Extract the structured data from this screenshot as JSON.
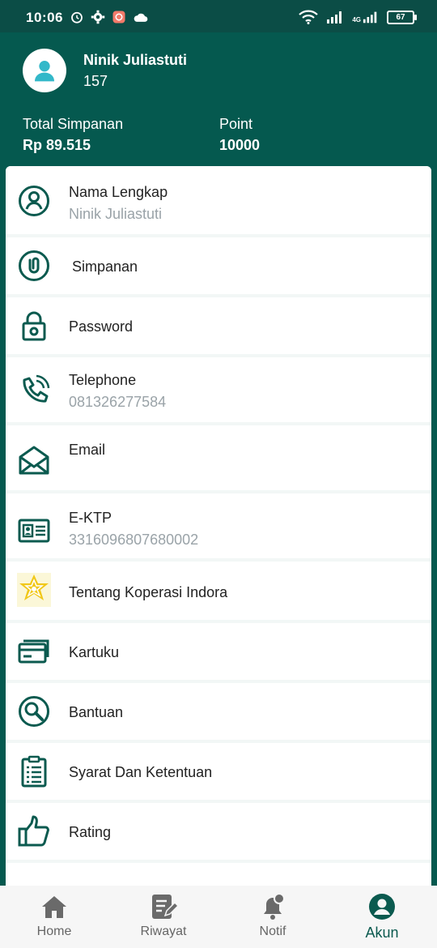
{
  "status_bar": {
    "time": "10:06",
    "battery": "67",
    "network": "4G"
  },
  "profile": {
    "name": "Ninik Juliastuti",
    "id": "157",
    "total_simpanan_label": "Total Simpanan",
    "total_simpanan_value": "Rp 89.515",
    "point_label": "Point",
    "point_value": "10000"
  },
  "menu": [
    {
      "title": "Nama Lengkap",
      "subtitle": "Ninik Juliastuti",
      "icon": "user-circle-icon"
    },
    {
      "title": "Simpanan",
      "subtitle": "",
      "icon": "savings-icon"
    },
    {
      "title": "Password",
      "subtitle": "",
      "icon": "lock-icon"
    },
    {
      "title": "Telephone",
      "subtitle": "081326277584",
      "icon": "phone-icon"
    },
    {
      "title": "Email",
      "subtitle": "",
      "icon": "envelope-icon"
    },
    {
      "title": "E-KTP",
      "subtitle": "3316096807680002",
      "icon": "id-card-icon"
    },
    {
      "title": "Tentang Koperasi Indora",
      "subtitle": "",
      "icon": "koperasi-logo-icon"
    },
    {
      "title": "Kartuku",
      "subtitle": "",
      "icon": "card-icon"
    },
    {
      "title": "Bantuan",
      "subtitle": "",
      "icon": "search-help-icon"
    },
    {
      "title": "Syarat Dan Ketentuan",
      "subtitle": "",
      "icon": "clipboard-icon"
    },
    {
      "title": "Rating",
      "subtitle": "",
      "icon": "thumbs-up-icon"
    }
  ],
  "bottom_nav": [
    {
      "label": "Home",
      "icon": "home-icon"
    },
    {
      "label": "Riwayat",
      "icon": "history-icon"
    },
    {
      "label": "Notif",
      "icon": "bell-icon"
    },
    {
      "label": "Akun",
      "icon": "account-icon",
      "active": true
    }
  ],
  "colors": {
    "primary": "#05594f",
    "status_bar": "#0b4d46",
    "icon": "#0b5a4f",
    "subtitle": "#9aa3a8",
    "nav_inactive": "#666666"
  }
}
